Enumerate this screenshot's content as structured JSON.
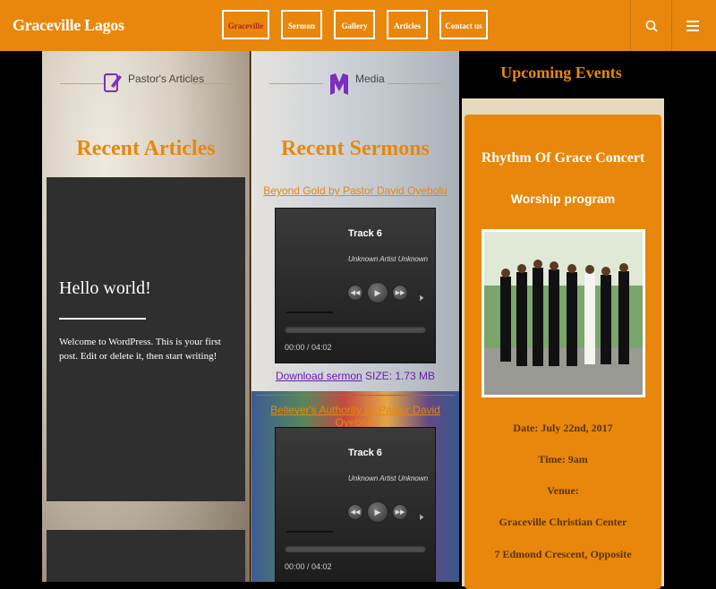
{
  "site": {
    "brand": "Graceville Lagos"
  },
  "nav": {
    "items": [
      {
        "label": "Graceville"
      },
      {
        "label": "Sermon"
      },
      {
        "label": "Gallery"
      },
      {
        "label": "Articles"
      },
      {
        "label": "Contact us"
      }
    ]
  },
  "icons": {
    "search": "search-icon",
    "menu": "menu-icon",
    "pen": "pen-icon",
    "media": "media-logo-icon"
  },
  "colors": {
    "accent": "#e8870b",
    "dark": "#2f2f2f",
    "link_download": "#6a1bb1"
  },
  "articles": {
    "tab_label": "Pastor's Articles",
    "heading": "Recent Articles",
    "post": {
      "title": "Hello world!",
      "excerpt": "Welcome to WordPress. This is your first post. Edit or delete it, then start writing!"
    }
  },
  "sermons": {
    "tab_label": "Media",
    "heading": "Recent Sermons",
    "items": [
      {
        "title": "Beyond Gold by Pastor David Oyebolu",
        "track": "Track 6",
        "artist": "Unknown Artist Unknown",
        "time": "00:00 / 04:02",
        "download_label": "Download sermon",
        "size": "SIZE: 1.73 MB"
      },
      {
        "title": "Believer's Authority by Pastor David Oyebolu",
        "track": "Track 6",
        "artist": "Unknown Artist Unknown",
        "time": "00:00 / 04:02"
      }
    ]
  },
  "events": {
    "heading": "Upcoming Events",
    "event": {
      "title": "Rhythm Of Grace Concert",
      "subtitle": "Worship program",
      "date": "Date: July 22nd, 2017",
      "time": "Time: 9am",
      "venue_label": "Venue:",
      "venue_name": "Graceville Christian Center",
      "address": "7 Edmond Crescent, Opposite"
    }
  }
}
